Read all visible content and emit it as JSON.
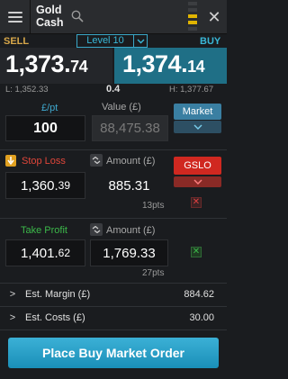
{
  "header": {
    "title": "Gold Cash",
    "close": "✕"
  },
  "quote": {
    "sell_label": "SELL",
    "buy_label": "BUY",
    "level": "Level 10",
    "sell_main": "1,373.",
    "sell_frac": "74",
    "buy_main": "1,374.",
    "buy_frac": "14",
    "low": "L: 1,352.33",
    "spread": "0.4",
    "high": "H: 1,377.67"
  },
  "size": {
    "ppt_label": "£/pt",
    "ppt_value": "100",
    "value_label": "Value (£)",
    "value_value": "88,475.38",
    "order_type": "Market"
  },
  "stop_loss": {
    "label": "Stop Loss",
    "amount_label": "Amount (£)",
    "level_main": "1,360.",
    "level_frac": "39",
    "amount": "885.31",
    "pts": "13pts",
    "type": "GSLO",
    "remove": "✕"
  },
  "take_profit": {
    "label": "Take Profit",
    "amount_label": "Amount (£)",
    "level_main": "1,401.",
    "level_frac": "62",
    "amount": "1,769.33",
    "pts": "27pts",
    "remove": "✕"
  },
  "estimates": [
    {
      "label": "Est. Margin (£)",
      "value": "884.62"
    },
    {
      "label": "Est. Costs (£)",
      "value": "30.00"
    }
  ],
  "action": {
    "label": "Place Buy Market Order"
  },
  "colors": {
    "sell": "#d8a84a",
    "buy": "#39b8d8",
    "stop_loss": "#e0463a",
    "take_profit": "#3cb84a",
    "gslo": "#d02820"
  }
}
